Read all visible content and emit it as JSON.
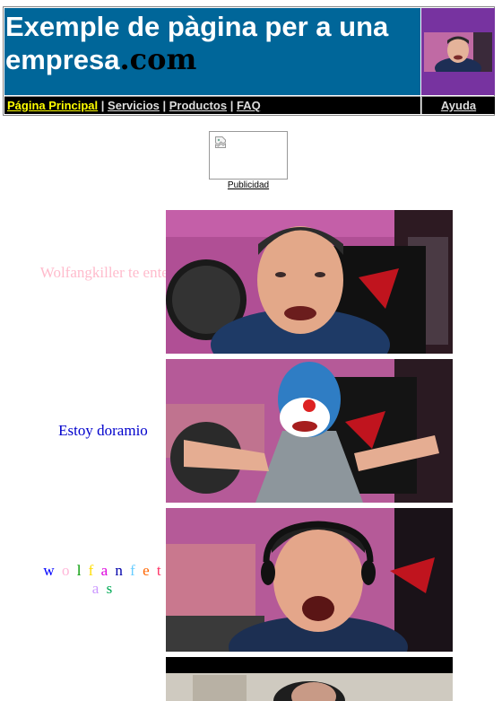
{
  "header": {
    "title_main": "Exemple de pàgina per a una empresa",
    "title_suffix": ".com",
    "avatar_alt": "webcam avatar"
  },
  "nav": {
    "items": [
      {
        "label": "Página Principal",
        "active": true
      },
      {
        "label": "Servicios",
        "active": false
      },
      {
        "label": "Productos",
        "active": false
      },
      {
        "label": "FAQ",
        "active": false
      }
    ],
    "separator": "|",
    "help_label": "Ayuda"
  },
  "ad": {
    "label": "Publicidad",
    "icon": "broken-image-icon"
  },
  "rows": [
    {
      "caption": "Wolfangkiller te enteras?",
      "color": "#ffbbcc"
    },
    {
      "caption": "Estoy doramio",
      "color": "#0000cc"
    },
    {
      "caption_letters": [
        "w",
        "o",
        "l",
        "f",
        "a",
        "n",
        "f",
        "e",
        "t",
        "a",
        "s"
      ],
      "letter_colors": [
        "#0000ff",
        "#ffb6d9",
        "#009900",
        "#ffdd00",
        "#dd00dd",
        "#0000aa",
        "#66ccff",
        "#ff6600",
        "#ff3366",
        "#cc99ff",
        "#00aa55"
      ]
    }
  ],
  "colors": {
    "header_bg": "#006699",
    "nav_bg": "#000000",
    "active_link": "#ffff00",
    "avatar_bg": "#7733a0"
  }
}
